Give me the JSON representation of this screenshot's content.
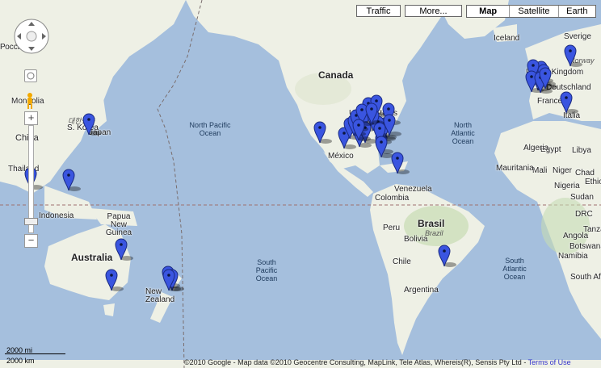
{
  "map": {
    "controls": {
      "traffic_label": "Traffic",
      "more_label": "More...",
      "map_types": [
        "Map",
        "Satellite",
        "Earth"
      ],
      "selected_map_type": "Map"
    },
    "labels": {
      "countries": [
        "Canada",
        "United States",
        "México",
        "Venezuela",
        "Colombia",
        "Peru",
        "Bolivia",
        "Chile",
        "Argentina",
        "Brasil",
        "Iceland",
        "Sverige",
        "Norway",
        "United Kingdom",
        "Deutschland",
        "France",
        "Italia",
        "Libya",
        "Egypt",
        "Algeria",
        "Mali",
        "Niger",
        "Chad",
        "Sudan",
        "Nigeria",
        "Mauritania",
        "DRC",
        "Angola",
        "Namibia",
        "Botswana",
        "South Africa",
        "Tanzania",
        "Ethiopia",
        "China",
        "Japan",
        "S. Korea",
        "Thailand",
        "Indonesia",
        "Papua New Guinea",
        "Australia",
        "New Zealand",
        "Россия",
        "Mongolia"
      ],
      "big": [
        "Canada",
        "Brasil",
        "Australia"
      ],
      "oceans": [
        "North Pacific Ocean",
        "North Atlantic Ocean",
        "South Pacific Ocean",
        "South Atlantic Ocean"
      ],
      "subtitles": [
        "Brazil",
        "대한민국"
      ]
    },
    "markers_count": 44,
    "scale": {
      "imperial": "2000 mi",
      "metric": "2000 km"
    },
    "copyright": "©2010 Google - Map data ©2010 Geocentre Consulting, MapLink, Tele Atlas, Whereis(R), Sensis Pty Ltd -",
    "terms_label": "Terms of Use"
  }
}
